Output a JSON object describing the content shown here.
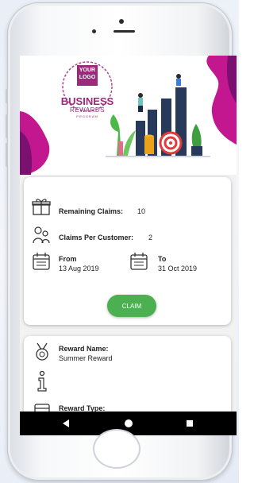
{
  "banner": {
    "logo_line1": "YOUR",
    "logo_line2": "LOGO",
    "brand_line1": "BUSINESS",
    "brand_line2": "REWARDS",
    "brand_line3": "PROGRAM"
  },
  "claims": {
    "remaining_label": "Remaining Claims:",
    "remaining_value": "10",
    "per_customer_label": "Claims Per Customer:",
    "per_customer_value": "2",
    "from_label": "From",
    "from_value": "13 Aug 2019",
    "to_label": "To",
    "to_value": "31 Oct 2019",
    "claim_button": "CLAIM"
  },
  "reward": {
    "name_label": "Reward Name:",
    "name_value": "Summer Reward",
    "type_label": "Reward Type:"
  },
  "colors": {
    "brand_purple": "#9c2a7a",
    "blob_magenta": "#c2178f",
    "claim_green": "#4caf50",
    "bar_navy": "#283a5c"
  },
  "icons": {
    "gift": "gift-icon",
    "people": "people-icon",
    "calendar": "calendar-icon",
    "medal": "medal-icon",
    "info": "info-icon",
    "nav_back": "back-triangle-icon",
    "nav_home": "home-circle-icon",
    "nav_recent": "recent-square-icon"
  }
}
